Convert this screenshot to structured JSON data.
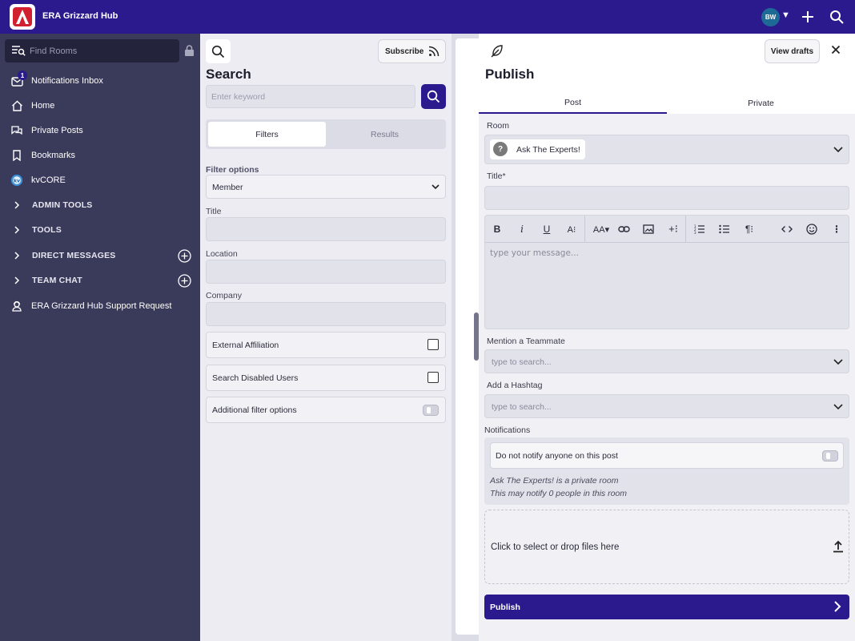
{
  "app": {
    "title": "ERA Grizzard Hub",
    "avatar_initials": "BW",
    "brand_color": "#2a1a8e"
  },
  "sidebar": {
    "find_rooms_placeholder": "Find Rooms",
    "notifications_badge": "1",
    "items": [
      {
        "label": "Notifications Inbox",
        "icon": "envelope-icon"
      },
      {
        "label": "Home",
        "icon": "home-icon"
      },
      {
        "label": "Private Posts",
        "icon": "chat-bubbles-icon"
      },
      {
        "label": "Bookmarks",
        "icon": "bookmark-icon"
      },
      {
        "label": "kvCORE",
        "icon": "kvcore-logo-icon"
      },
      {
        "label": "ADMIN TOOLS",
        "icon": "chevron-right-icon"
      },
      {
        "label": "TOOLS",
        "icon": "chevron-right-icon"
      },
      {
        "label": "DIRECT MESSAGES",
        "icon": "chevron-right-icon"
      },
      {
        "label": "TEAM CHAT",
        "icon": "chevron-right-icon"
      },
      {
        "label": "ERA Grizzard Hub Support Request",
        "icon": "support-person-icon"
      }
    ]
  },
  "search": {
    "heading": "Search",
    "subscribe_label": "Subscribe",
    "keyword_placeholder": "Enter keyword",
    "tabs": [
      "Filters",
      "Results"
    ],
    "active_tab": "Filters",
    "filter_options_label": "Filter options",
    "filter_select_value": "Member",
    "title_label": "Title",
    "location_label": "Location",
    "company_label": "Company",
    "external_affiliation_label": "External Affiliation",
    "search_disabled_label": "Search Disabled Users",
    "additional_filter_label": "Additional filter options"
  },
  "publish": {
    "heading": "Publish",
    "view_drafts_label": "View drafts",
    "tabs": [
      "Post",
      "Private"
    ],
    "active_tab": "Post",
    "room_label": "Room",
    "room_value": "Ask The Experts!",
    "title_label": "Title*",
    "message_placeholder": "type your message...",
    "mention_label": "Mention a Teammate",
    "mention_placeholder": "type to search...",
    "hashtag_label": "Add a Hashtag",
    "hashtag_placeholder": "type to search...",
    "notifications_label": "Notifications",
    "do_not_notify_label": "Do not notify anyone on this post",
    "private_room_note": "Ask The Experts! is a private room",
    "notify_count_note": "This may notify 0 people in this room",
    "dropzone_label": "Click to select or drop files here",
    "publish_button_label": "Publish",
    "toolbar": [
      "bold",
      "italic",
      "underline",
      "text-style",
      "font-size",
      "link",
      "image",
      "insert",
      "ordered-list",
      "bullet-list",
      "paragraph",
      "code",
      "emoji",
      "more"
    ]
  }
}
